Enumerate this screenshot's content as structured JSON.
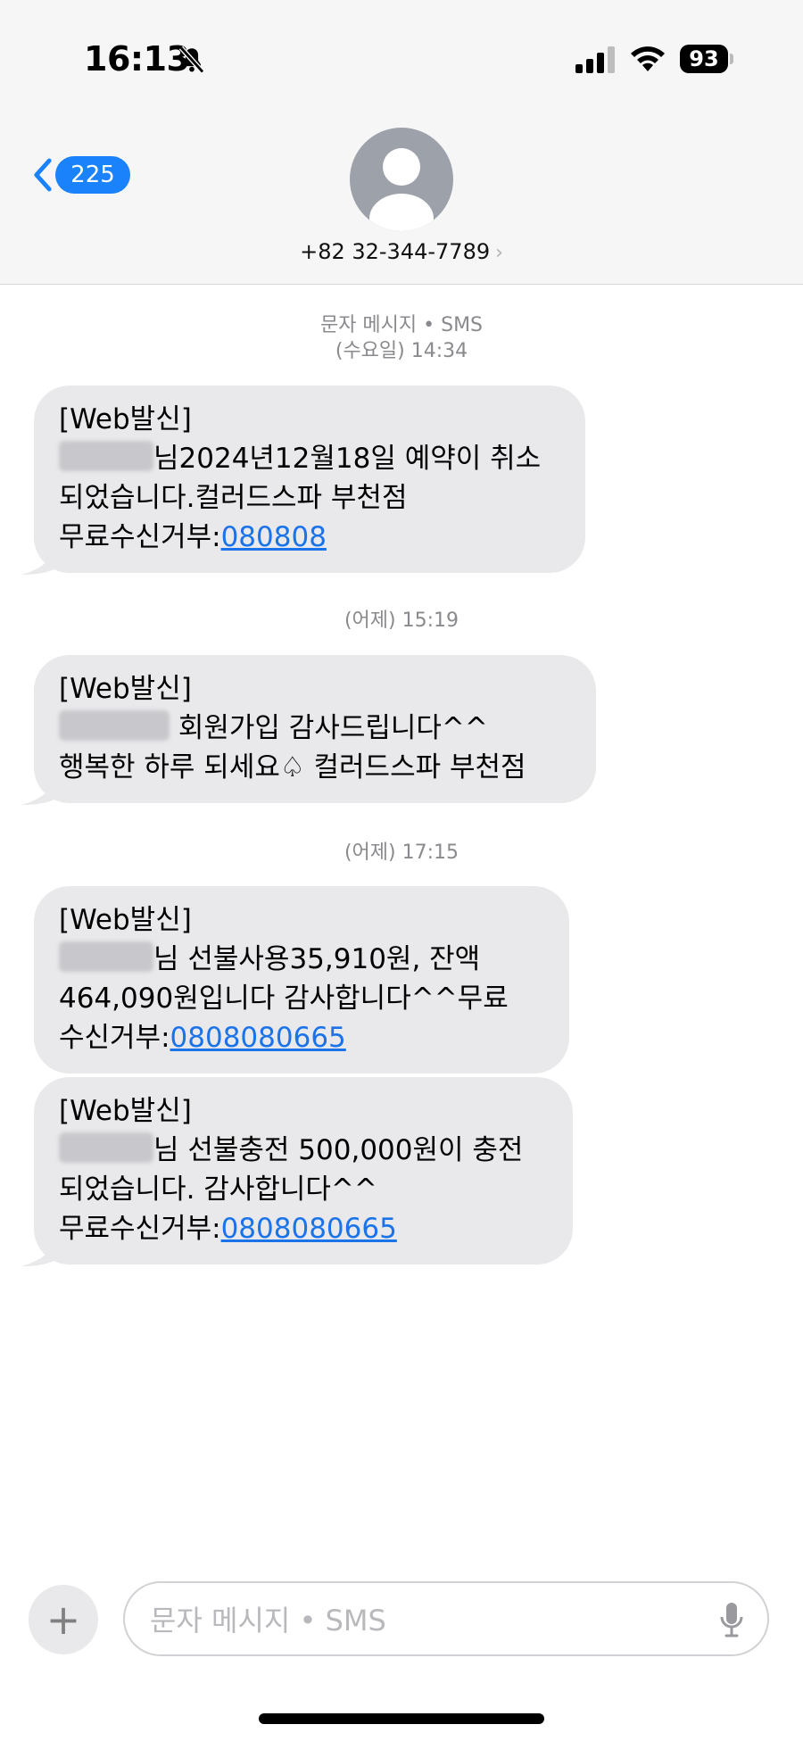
{
  "status_bar": {
    "time": "16:13",
    "silent_icon": "bell-slash-icon",
    "signal_icon": "cellular-signal-icon",
    "wifi_icon": "wifi-icon",
    "battery_level": "93"
  },
  "header": {
    "back_count": "225",
    "contact_number": "+82 32-344-7789",
    "avatar_icon": "person-icon"
  },
  "thread": {
    "service_label": "문자 메시지 • SMS",
    "first_timestamp": "(수요일) 14:34"
  },
  "messages": [
    {
      "lines": [
        "[Web발신]",
        "님2024년12월18일 예약이 취소",
        "되었습니다.컬러드스파 부천점"
      ],
      "link_prefix": "무료수신거부:",
      "link": "080808"
    },
    {
      "timestamp": "(어제) 15:19",
      "lines": [
        "[Web발신]",
        " 회원가입 감사드립니다^^",
        "행복한 하루 되세요♤ 컬러드스파 부천점"
      ]
    },
    {
      "timestamp": "(어제) 17:15",
      "lines": [
        "[Web발신]",
        "님 선불사용35,910원, 잔액",
        "464,090원입니다 감사합니다^^무료"
      ],
      "link_prefix": "수신거부:",
      "link": "0808080665"
    },
    {
      "lines": [
        "[Web발신]",
        "님 선불충전 500,000원이 충전",
        "되었습니다. 감사합니다^^"
      ],
      "link_prefix": "무료수신거부:",
      "link": "0808080665"
    }
  ],
  "composer": {
    "placeholder": "문자 메시지 • SMS",
    "plus_label": "+"
  },
  "colors": {
    "accent": "#1a82fb",
    "bubble": "#e9e9eb",
    "link": "#1a73e8"
  }
}
